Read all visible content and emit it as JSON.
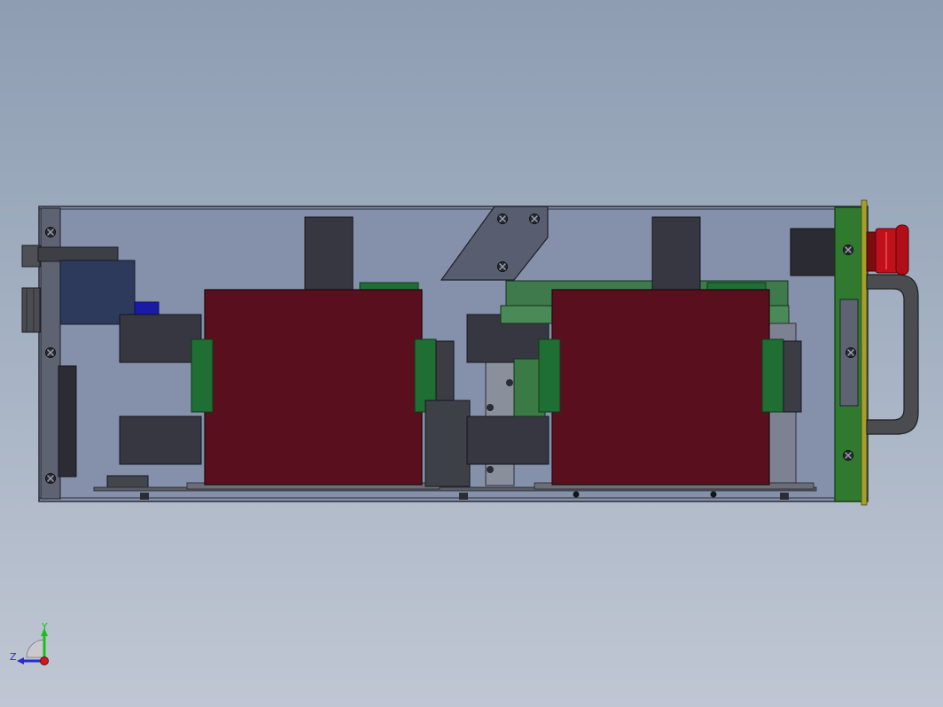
{
  "colors": {
    "background_top": "#8e9db2",
    "background_bottom": "#c0c7d3",
    "enclosure_fill": "#8591ab",
    "enclosure_edge": "#2b2d36",
    "dark_component": "#363740",
    "transformer_red": "#5a0f1e",
    "pcb_green": "#1f6e33",
    "front_panel_green": "#2f7a2e",
    "estop_red": "#c0101a",
    "handle_grey": "#4a4c50",
    "motor_blue": "#2e3a5c",
    "axis_y": "#18c018",
    "axis_z": "#2a2ad0",
    "axis_x": "#d01818"
  },
  "triad": {
    "y_label": "Y",
    "z_label": "Z"
  },
  "icons": {
    "screw": "screw-icon",
    "triad": "coordinate-triad-icon"
  }
}
